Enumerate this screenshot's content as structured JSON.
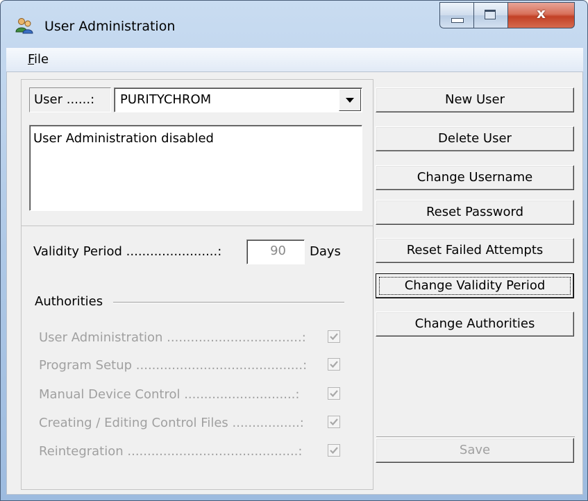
{
  "window": {
    "title": "User Administration",
    "close_glyph": "x"
  },
  "menu": {
    "file_accel": "F",
    "file_rest": "ile"
  },
  "user_selector": {
    "label": "User ......:",
    "value": "PURITYCHROM"
  },
  "info_text": "User Administration disabled",
  "validity": {
    "label": "Validity Period .......................:",
    "value": "90",
    "unit": "Days"
  },
  "authorities": {
    "heading": "Authorities",
    "items": [
      {
        "label": "User Administration ..................................:",
        "checked": true
      },
      {
        "label": "Program Setup ..........................................:",
        "checked": true
      },
      {
        "label": "Manual Device Control ............................:",
        "checked": true
      },
      {
        "label": "Creating / Editing Control Files .................:",
        "checked": true
      },
      {
        "label": "Reintegration ...........................................:",
        "checked": true
      }
    ]
  },
  "buttons": {
    "new_user": "New User",
    "delete_user": "Delete User",
    "change_username": "Change Username",
    "reset_password": "Reset Password",
    "reset_failed": "Reset Failed Attempts",
    "change_validity": "Change Validity Period",
    "change_authorities": "Change Authorities",
    "save": "Save"
  },
  "icons": {
    "app": "users-icon",
    "minimize": "minimize-icon",
    "maximize": "maximize-icon",
    "close": "close-icon",
    "dropdown": "chevron-down-icon",
    "check": "checkmark-icon"
  },
  "colors": {
    "title_bar": "#b9d1ea",
    "close_button": "#c8462b",
    "face": "#f0f0f0",
    "disabled_text": "#a0a0a0"
  }
}
